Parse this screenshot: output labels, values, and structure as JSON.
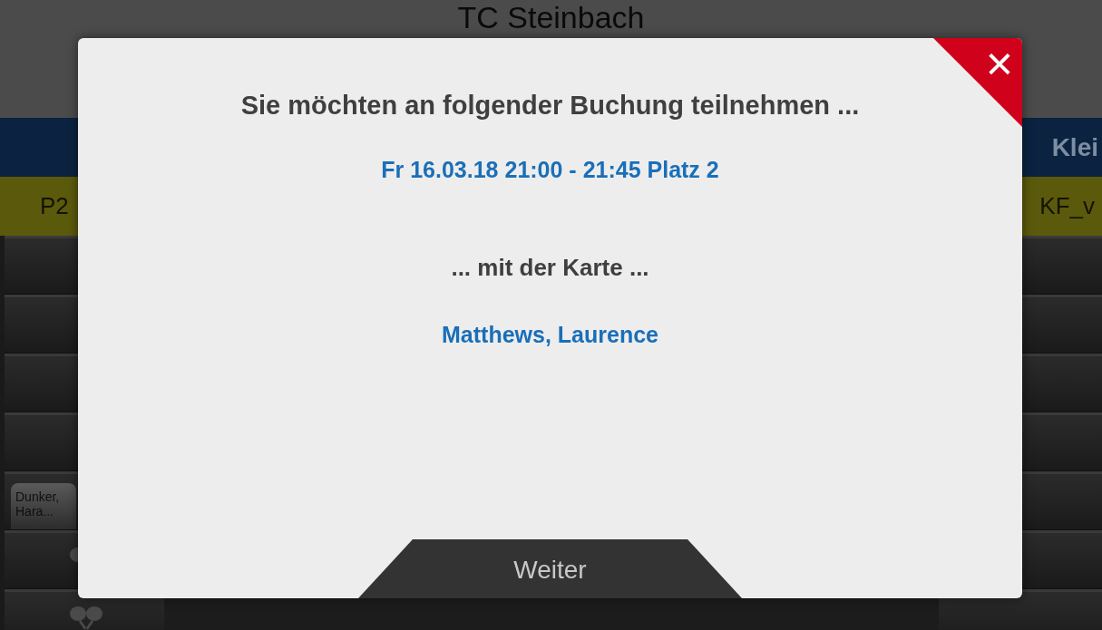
{
  "page": {
    "title": "TC Steinbach",
    "group_header": "Klei",
    "courts": [
      "P2",
      "KF_v"
    ],
    "booking": {
      "label": "Dunker, Hara..."
    }
  },
  "dialog": {
    "heading": "Sie möchten an folgender Buchung teilnehmen ...",
    "booking": "Fr 16.03.18 21:00 - 21:45 Platz 2",
    "card_heading": "... mit der Karte ...",
    "card_holder": "Matthews, Laurence",
    "close": "×",
    "continue_button": "Weiter"
  }
}
